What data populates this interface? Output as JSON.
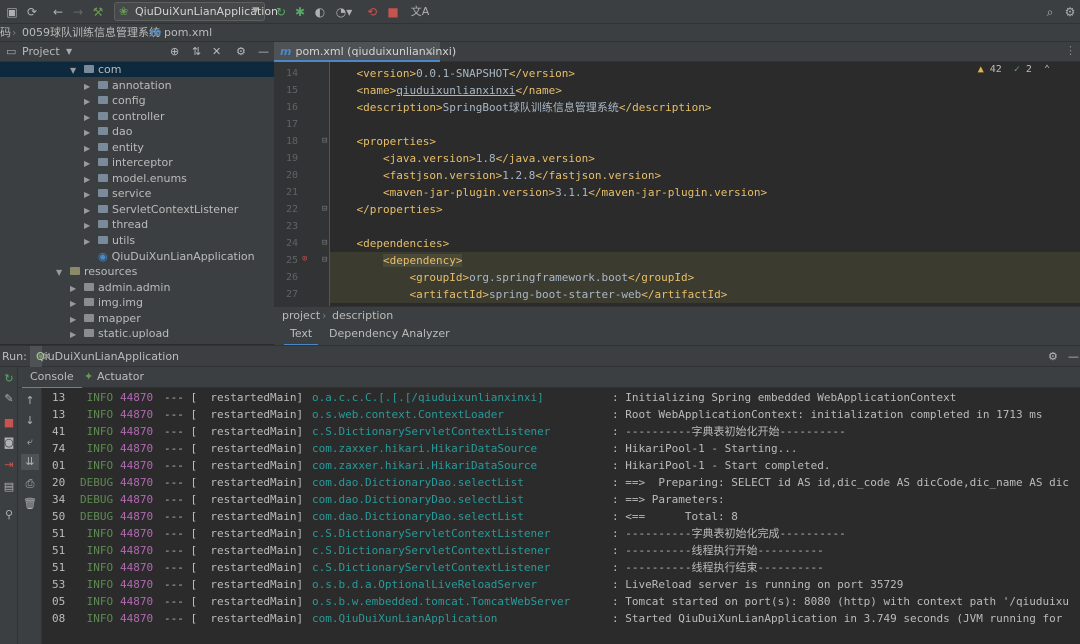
{
  "toolbar": {
    "run_config": "QiuDuiXunLianApplication",
    "translate_icon": "文A"
  },
  "navbar": {
    "crumbs": [
      "码",
      "0059球队训练信息管理系统",
      "pom.xml"
    ]
  },
  "project_panel": {
    "title": "Project",
    "tree": [
      {
        "label": "com",
        "indent": 5,
        "type": "pkg",
        "open": true
      },
      {
        "label": "annotation",
        "indent": 6,
        "type": "pkg",
        "open": false
      },
      {
        "label": "config",
        "indent": 6,
        "type": "pkg",
        "open": false
      },
      {
        "label": "controller",
        "indent": 6,
        "type": "pkg",
        "open": false
      },
      {
        "label": "dao",
        "indent": 6,
        "type": "pkg",
        "open": false
      },
      {
        "label": "entity",
        "indent": 6,
        "type": "pkg",
        "open": false
      },
      {
        "label": "interceptor",
        "indent": 6,
        "type": "pkg",
        "open": false
      },
      {
        "label": "model.enums",
        "indent": 6,
        "type": "pkg",
        "open": false
      },
      {
        "label": "service",
        "indent": 6,
        "type": "pkg",
        "open": false
      },
      {
        "label": "ServletContextListener",
        "indent": 6,
        "type": "pkg",
        "open": false
      },
      {
        "label": "thread",
        "indent": 6,
        "type": "pkg",
        "open": false
      },
      {
        "label": "utils",
        "indent": 6,
        "type": "pkg",
        "open": false
      },
      {
        "label": "QiuDuiXunLianApplication",
        "indent": 6,
        "type": "class",
        "open": null
      },
      {
        "label": "resources",
        "indent": 4,
        "type": "res",
        "open": true
      },
      {
        "label": "admin.admin",
        "indent": 5,
        "type": "pkg",
        "open": false
      },
      {
        "label": "img.img",
        "indent": 5,
        "type": "pkg",
        "open": false
      },
      {
        "label": "mapper",
        "indent": 5,
        "type": "pkg",
        "open": false
      },
      {
        "label": "static.upload",
        "indent": 5,
        "type": "pkg",
        "open": false
      }
    ]
  },
  "editor": {
    "tab_label": "pom.xml (qiuduixunlianxinxi)",
    "inspections": {
      "warnings": "42",
      "weak_warnings": "2"
    },
    "lines": [
      {
        "n": "14",
        "indent": "    ",
        "open": "<version>",
        "text": "0.0.1-SNAPSHOT",
        "close": "</version>"
      },
      {
        "n": "15",
        "indent": "    ",
        "open": "<name>",
        "text": "qiuduixunlianxinxi",
        "close": "</name>"
      },
      {
        "n": "16",
        "indent": "    ",
        "open": "<description>",
        "text": "SpringBoot球队训练信息管理系统",
        "close": "</description>"
      },
      {
        "n": "17",
        "indent": "",
        "open": "",
        "text": "",
        "close": ""
      },
      {
        "n": "18",
        "indent": "    ",
        "open": "<properties>",
        "text": "",
        "close": ""
      },
      {
        "n": "19",
        "indent": "        ",
        "open": "<java.version>",
        "text": "1.8",
        "close": "</java.version>"
      },
      {
        "n": "20",
        "indent": "        ",
        "open": "<fastjson.version>",
        "text": "1.2.8",
        "close": "</fastjson.version>"
      },
      {
        "n": "21",
        "indent": "        ",
        "open": "<maven-jar-plugin.version>",
        "text": "3.1.1",
        "close": "</maven-jar-plugin.version>"
      },
      {
        "n": "22",
        "indent": "    ",
        "open": "</properties>",
        "text": "",
        "close": ""
      },
      {
        "n": "23",
        "indent": "",
        "open": "",
        "text": "",
        "close": ""
      },
      {
        "n": "24",
        "indent": "    ",
        "open": "<dependencies>",
        "text": "",
        "close": ""
      },
      {
        "n": "25",
        "indent": "        ",
        "open": "<dependency>",
        "text": "",
        "close": ""
      },
      {
        "n": "26",
        "indent": "            ",
        "open": "<groupId>",
        "text": "org.springframework.boot",
        "close": "</groupId>"
      },
      {
        "n": "27",
        "indent": "            ",
        "open": "<artifactId>",
        "text": "spring-boot-starter-web",
        "close": "</artifactId>"
      }
    ],
    "breadcrumb": [
      "project",
      "description"
    ],
    "subtabs": [
      "Text",
      "Dependency Analyzer"
    ]
  },
  "run_panel": {
    "label": "Run:",
    "tab": "QiuDuiXunLianApplication",
    "console_tabs": [
      "Console",
      "Actuator"
    ],
    "log": [
      {
        "n": "13",
        "lvl": " INFO",
        "pid": "44870",
        "th": "restartedMain]",
        "logger": "o.a.c.c.C.[.[.[/qiuduixunlianxinxi]",
        "msg": "Initializing Spring embedded WebApplicationContext"
      },
      {
        "n": "13",
        "lvl": " INFO",
        "pid": "44870",
        "th": "restartedMain]",
        "logger": "o.s.web.context.ContextLoader",
        "msg": "Root WebApplicationContext: initialization completed in 1713 ms"
      },
      {
        "n": "41",
        "lvl": " INFO",
        "pid": "44870",
        "th": "restartedMain]",
        "logger": "c.S.DictionaryServletContextListener",
        "msg": "----------字典表初始化开始----------"
      },
      {
        "n": "74",
        "lvl": " INFO",
        "pid": "44870",
        "th": "restartedMain]",
        "logger": "com.zaxxer.hikari.HikariDataSource",
        "msg": "HikariPool-1 - Starting..."
      },
      {
        "n": "01",
        "lvl": " INFO",
        "pid": "44870",
        "th": "restartedMain]",
        "logger": "com.zaxxer.hikari.HikariDataSource",
        "msg": "HikariPool-1 - Start completed."
      },
      {
        "n": "20",
        "lvl": "DEBUG",
        "pid": "44870",
        "th": "restartedMain]",
        "logger": "com.dao.DictionaryDao.selectList",
        "msg": "==>  Preparing: SELECT id AS id,dic_code AS dicCode,dic_name AS dic"
      },
      {
        "n": "34",
        "lvl": "DEBUG",
        "pid": "44870",
        "th": "restartedMain]",
        "logger": "com.dao.DictionaryDao.selectList",
        "msg": "==> Parameters:"
      },
      {
        "n": "50",
        "lvl": "DEBUG",
        "pid": "44870",
        "th": "restartedMain]",
        "logger": "com.dao.DictionaryDao.selectList",
        "msg": "<==      Total: 8"
      },
      {
        "n": "51",
        "lvl": " INFO",
        "pid": "44870",
        "th": "restartedMain]",
        "logger": "c.S.DictionaryServletContextListener",
        "msg": "----------字典表初始化完成----------"
      },
      {
        "n": "51",
        "lvl": " INFO",
        "pid": "44870",
        "th": "restartedMain]",
        "logger": "c.S.DictionaryServletContextListener",
        "msg": "----------线程执行开始----------"
      },
      {
        "n": "51",
        "lvl": " INFO",
        "pid": "44870",
        "th": "restartedMain]",
        "logger": "c.S.DictionaryServletContextListener",
        "msg": "----------线程执行结束----------"
      },
      {
        "n": "53",
        "lvl": " INFO",
        "pid": "44870",
        "th": "restartedMain]",
        "logger": "o.s.b.d.a.OptionalLiveReloadServer",
        "msg": "LiveReload server is running on port 35729"
      },
      {
        "n": "05",
        "lvl": " INFO",
        "pid": "44870",
        "th": "restartedMain]",
        "logger": "o.s.b.w.embedded.tomcat.TomcatWebServer",
        "msg": "Tomcat started on port(s): 8080 (http) with context path '/qiuduixu"
      },
      {
        "n": "08",
        "lvl": " INFO",
        "pid": "44870",
        "th": "restartedMain]",
        "logger": "com.QiuDuiXunLianApplication",
        "msg": "Started QiuDuiXunLianApplication in 3.749 seconds (JVM running for"
      }
    ]
  }
}
